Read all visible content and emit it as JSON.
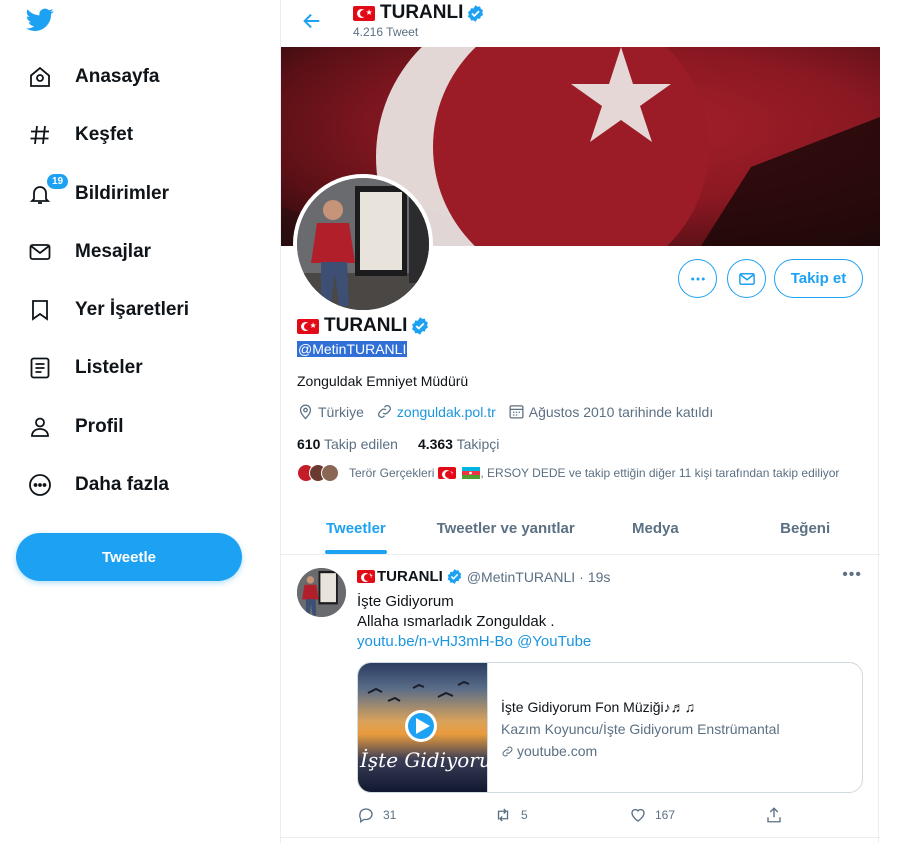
{
  "nav": {
    "items": [
      {
        "label": "Anasayfa",
        "icon": "home-icon"
      },
      {
        "label": "Keşfet",
        "icon": "hashtag-icon"
      },
      {
        "label": "Bildirimler",
        "icon": "bell-icon",
        "badge": "19"
      },
      {
        "label": "Mesajlar",
        "icon": "envelope-icon"
      },
      {
        "label": "Yer İşaretleri",
        "icon": "bookmark-icon"
      },
      {
        "label": "Listeler",
        "icon": "list-icon"
      },
      {
        "label": "Profil",
        "icon": "person-icon"
      },
      {
        "label": "Daha fazla",
        "icon": "more-circle-icon"
      }
    ],
    "tweet_button": "Tweetle"
  },
  "header": {
    "name": "TURANLI",
    "tweet_count": "4.216 Tweet"
  },
  "profile": {
    "name": "TURANLI",
    "handle": "@MetinTURANLI",
    "bio": "Zonguldak Emniyet Müdürü",
    "location": "Türkiye",
    "website": "zonguldak.pol.tr",
    "joined": "Ağustos 2010 tarihinde katıldı",
    "following_count": "610",
    "following_label": "Takip edilen",
    "followers_count": "4.363",
    "followers_label": "Takipçi",
    "followed_by_a": "Terör Gerçekleri",
    "followed_by_b": ", ERSOY DEDE ve takip ettiğin diğer 11 kişi tarafından takip ediliyor",
    "follow_button": "Takip et"
  },
  "tabs": [
    {
      "label": "Tweetler",
      "active": true
    },
    {
      "label": "Tweetler ve yanıtlar",
      "active": false
    },
    {
      "label": "Medya",
      "active": false
    },
    {
      "label": "Beğeni",
      "active": false
    }
  ],
  "tweet": {
    "name": "TURANLI",
    "handle": "@MetinTURANLI",
    "separator": "·",
    "time": "19s",
    "line1": "İşte Gidiyorum",
    "line2": "Allaha ısmarladık Zonguldak .",
    "link": "youtu.be/n-vHJ3mH-Bo",
    "mention": "@YouTube",
    "card": {
      "image_text": "İşte Gidiyorum",
      "title": "İşte Gidiyorum Fon Müziği♪♬♫",
      "subtitle": "Kazım Koyuncu/İşte Gidiyorum Enstrümantal",
      "domain": "youtube.com"
    },
    "replies": "31",
    "retweets": "5",
    "likes": "167"
  },
  "colors": {
    "accent": "#1da1f2",
    "flag_red": "#e30a17",
    "muted": "#5b7083"
  }
}
